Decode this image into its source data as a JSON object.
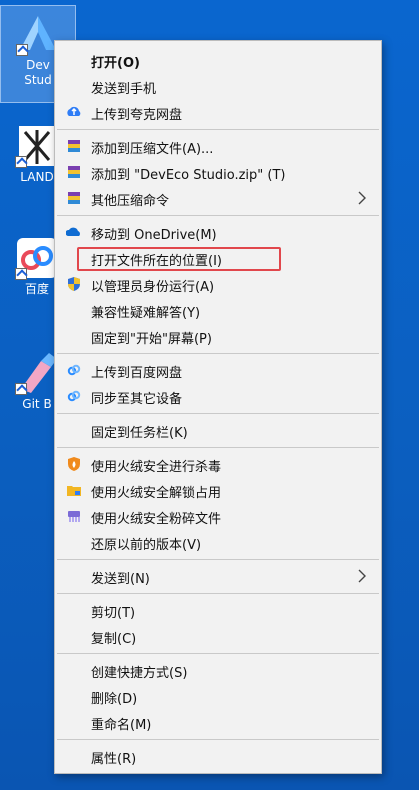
{
  "desktop_icons": [
    {
      "id": "deveco",
      "label_line1": "Dev",
      "label_line2": "Stud"
    },
    {
      "id": "land",
      "label_line1": "LAND"
    },
    {
      "id": "baidu",
      "label_line1": "百度"
    },
    {
      "id": "git",
      "label_line1": "Git B"
    }
  ],
  "menu": {
    "items": [
      {
        "label": "打开(O)"
      },
      {
        "label": "发送到手机"
      },
      {
        "label": "上传到夸克网盘"
      },
      {
        "label": "添加到压缩文件(A)..."
      },
      {
        "label": "添加到 \"DevEco Studio.zip\" (T)"
      },
      {
        "label": "其他压缩命令"
      },
      {
        "label": "移动到 OneDrive(M)"
      },
      {
        "label": "打开文件所在的位置(I)"
      },
      {
        "label": "以管理员身份运行(A)"
      },
      {
        "label": "兼容性疑难解答(Y)"
      },
      {
        "label": "固定到\"开始\"屏幕(P)"
      },
      {
        "label": "上传到百度网盘"
      },
      {
        "label": "同步至其它设备"
      },
      {
        "label": "固定到任务栏(K)"
      },
      {
        "label": "使用火绒安全进行杀毒"
      },
      {
        "label": "使用火绒安全解锁占用"
      },
      {
        "label": "使用火绒安全粉碎文件"
      },
      {
        "label": "还原以前的版本(V)"
      },
      {
        "label": "发送到(N)"
      },
      {
        "label": "剪切(T)"
      },
      {
        "label": "复制(C)"
      },
      {
        "label": "创建快捷方式(S)"
      },
      {
        "label": "删除(D)"
      },
      {
        "label": "重命名(M)"
      },
      {
        "label": "属性(R)"
      }
    ]
  },
  "colors": {
    "highlight_border": "#e1474c",
    "menu_bg": "#f2f2f2"
  }
}
